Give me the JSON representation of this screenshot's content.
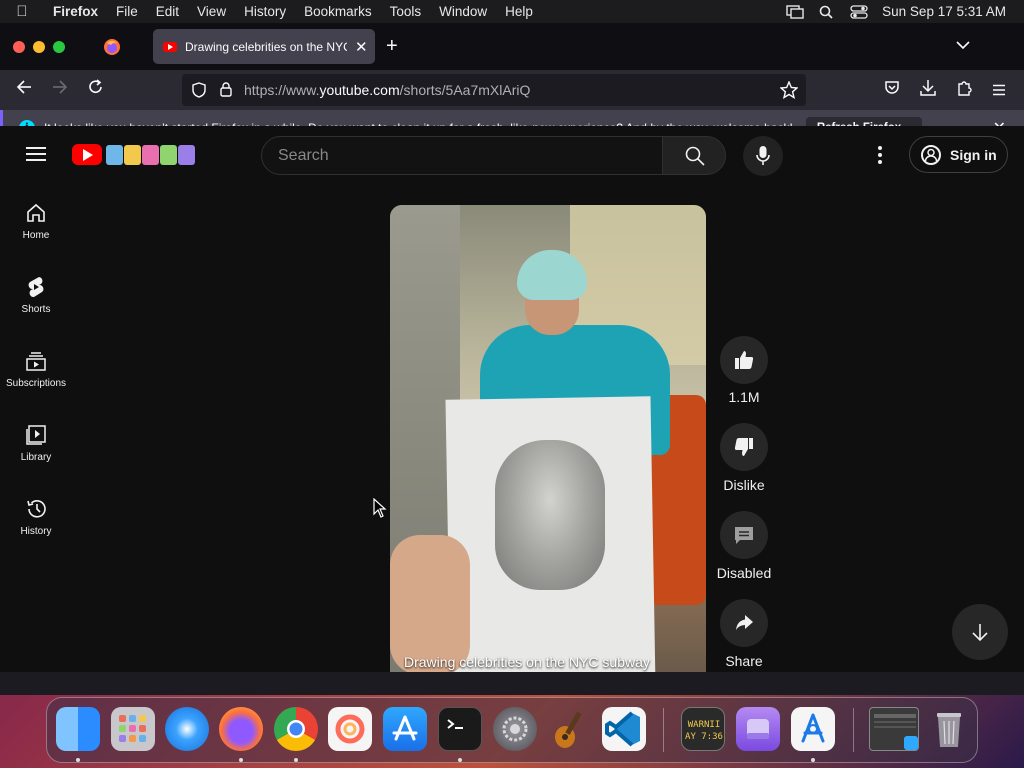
{
  "menubar": {
    "app_name": "Firefox",
    "items": [
      "File",
      "Edit",
      "View",
      "History",
      "Bookmarks",
      "Tools",
      "Window",
      "Help"
    ],
    "clock": "Sun Sep 17  5:31 AM"
  },
  "browser": {
    "tab_title": "Drawing celebrities on the NYC",
    "url_prefix": "https://www.",
    "url_domain": "youtube.com",
    "url_path": "/shorts/5Aa7mXlAriQ",
    "notification_text": "It looks like you haven’t started Firefox in a while. Do you want to clean it up for a fresh, like-new experience? And by the way, welcome back!",
    "notification_button": "Refresh Firefox..."
  },
  "youtube": {
    "search_placeholder": "Search",
    "sign_in_label": "Sign in",
    "sidebar": [
      {
        "label": "Home",
        "icon": "home-icon"
      },
      {
        "label": "Shorts",
        "icon": "shorts-icon"
      },
      {
        "label": "Subscriptions",
        "icon": "subscriptions-icon"
      },
      {
        "label": "Library",
        "icon": "library-icon"
      },
      {
        "label": "History",
        "icon": "history-icon"
      }
    ],
    "video_caption": "Drawing celebrities on the NYC subway",
    "actions": {
      "like_count": "1.1M",
      "dislike_label": "Dislike",
      "comments_label": "Disabled",
      "share_label": "Share"
    }
  },
  "dock": {
    "apps": [
      "Finder",
      "Launchpad",
      "Safari",
      "Firefox",
      "Chrome",
      "Elytra",
      "App Store",
      "Terminal",
      "System Settings",
      "GarageBand",
      "Visual Studio Code",
      "Console",
      "Disk Utility",
      "Xcode Instruments",
      "Screenshot",
      "Trash"
    ],
    "console_icon_text": [
      "WARNII",
      "AY 7:36"
    ]
  }
}
